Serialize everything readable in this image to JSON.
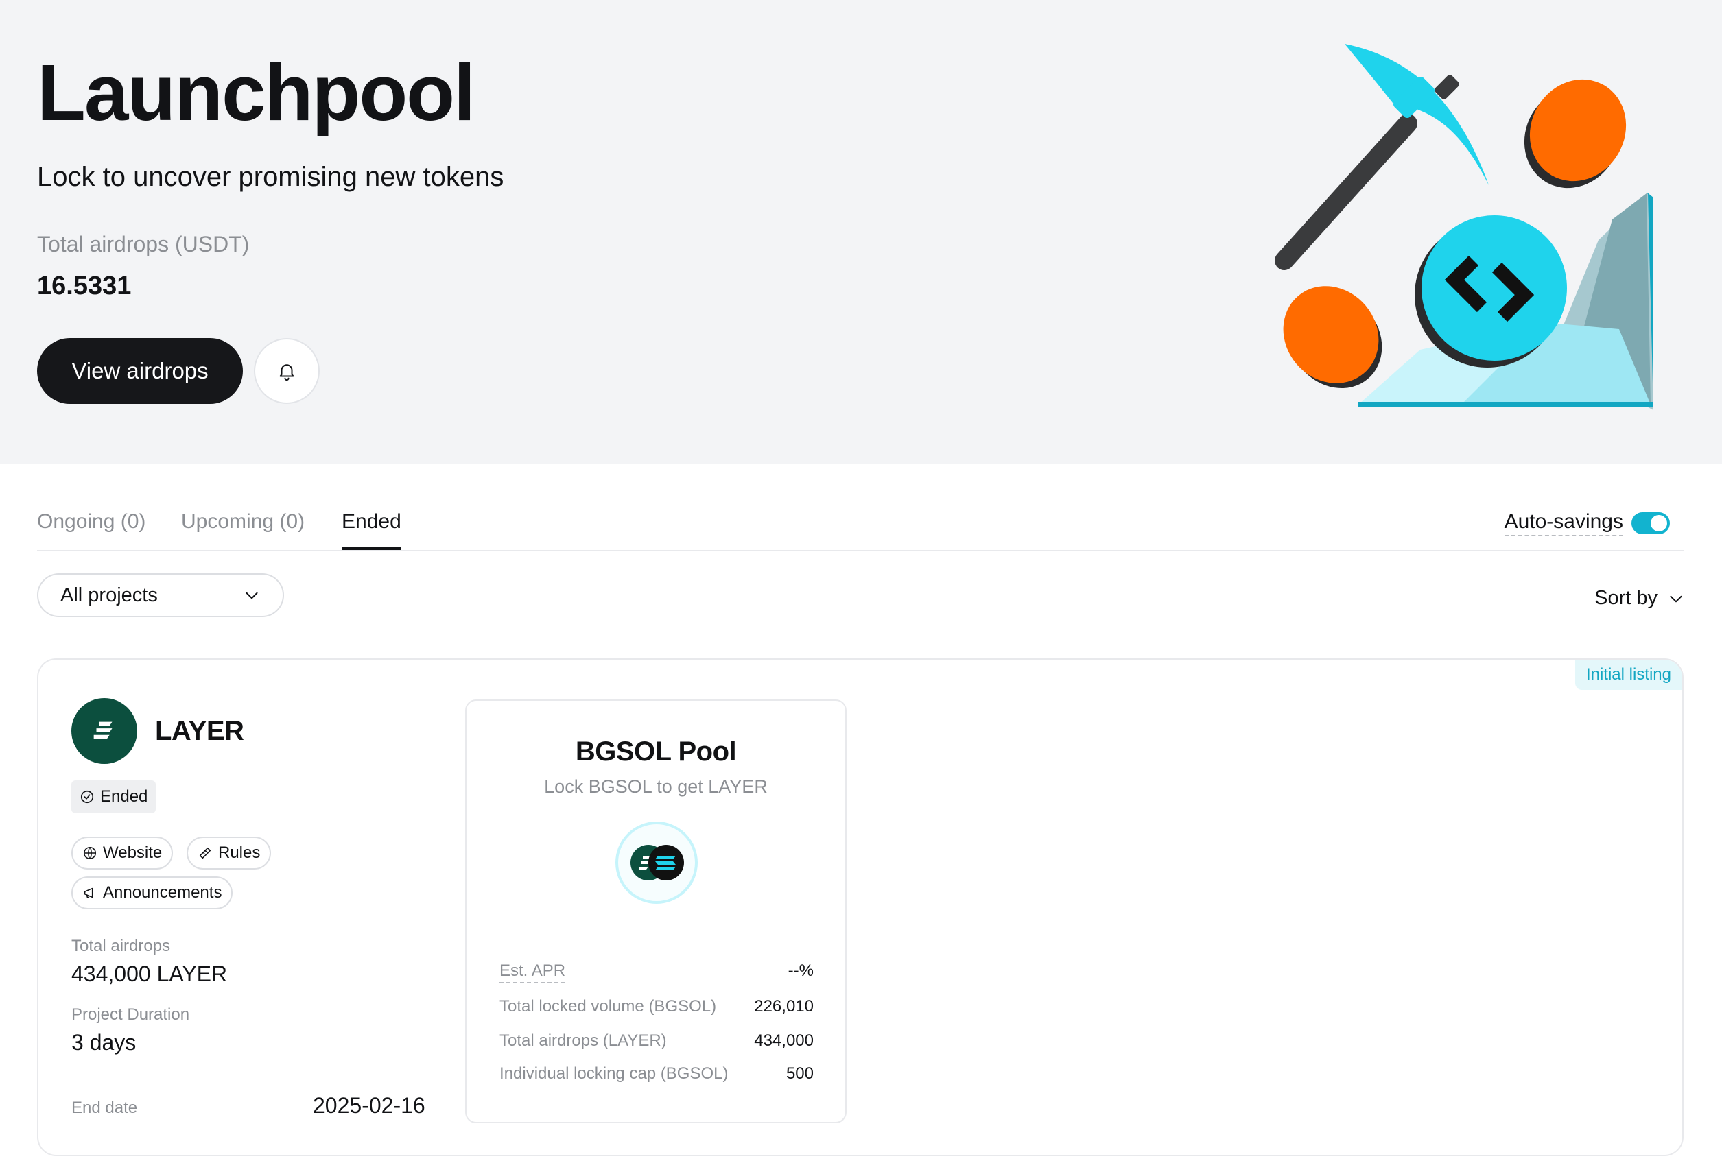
{
  "hero": {
    "title": "Launchpool",
    "subtitle": "Lock to uncover promising new tokens",
    "total_label": "Total airdrops (USDT)",
    "total_value": "16.5331",
    "view_button": "View airdrops"
  },
  "tabs": [
    {
      "label": "Ongoing (0)"
    },
    {
      "label": "Upcoming (0)"
    },
    {
      "label": "Ended"
    }
  ],
  "active_tab": "Ended",
  "auto_savings": {
    "label": "Auto-savings",
    "enabled": true
  },
  "filter": {
    "projects": "All projects",
    "sort": "Sort by"
  },
  "project": {
    "badge": "Initial listing",
    "name": "LAYER",
    "status": "Ended",
    "links": {
      "website": "Website",
      "rules": "Rules",
      "announcements": "Announcements"
    },
    "total_airdrops_label": "Total airdrops",
    "total_airdrops_value": "434,000 LAYER",
    "duration_label": "Project Duration",
    "duration_value": "3 days",
    "end_date_label": "End date",
    "end_date_value": "2025-02-16",
    "pool": {
      "title": "BGSOL Pool",
      "subtitle": "Lock BGSOL to get LAYER",
      "stats": [
        {
          "label": "Est. APR",
          "value": "--%"
        },
        {
          "label": "Total locked volume (BGSOL)",
          "value": "226,010"
        },
        {
          "label": "Total airdrops (LAYER)",
          "value": "434,000"
        },
        {
          "label": "Individual locking cap (BGSOL)",
          "value": "500"
        }
      ]
    }
  },
  "colors": {
    "accent": "#12b3cf",
    "brand_dark": "#16171a",
    "layer_green": "#0c4f3e",
    "coin_orange": "#ff6b00",
    "coin_cyan": "#1fd3ec"
  }
}
